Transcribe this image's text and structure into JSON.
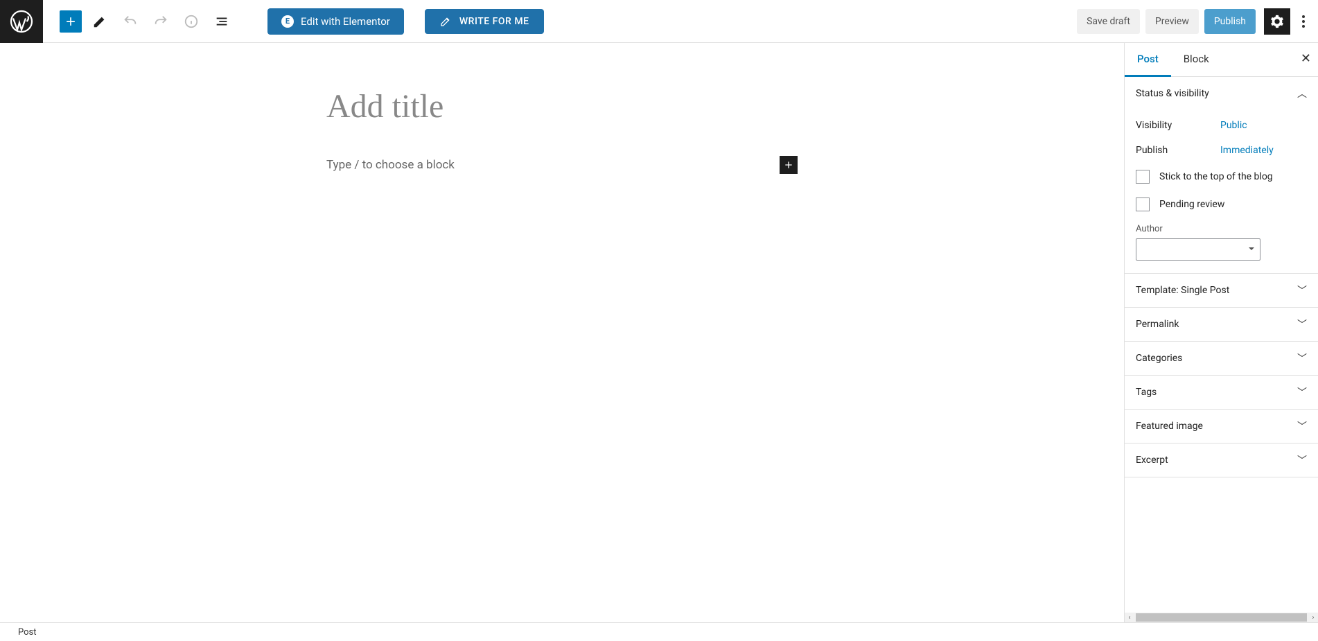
{
  "toolbar": {
    "elementor_label": "Edit with Elementor",
    "write_label": "WRITE FOR ME",
    "save_draft": "Save draft",
    "preview": "Preview",
    "publish": "Publish"
  },
  "editor": {
    "title_placeholder": "Add title",
    "block_prompt": "Type / to choose a block"
  },
  "sidebar": {
    "tabs": {
      "post": "Post",
      "block": "Block"
    },
    "panels": {
      "status": {
        "title": "Status & visibility",
        "visibility_label": "Visibility",
        "visibility_value": "Public",
        "publish_label": "Publish",
        "publish_value": "Immediately",
        "stick_label": "Stick to the top of the blog",
        "pending_label": "Pending review",
        "author_label": "Author"
      },
      "template": "Template: Single Post",
      "permalink": "Permalink",
      "categories": "Categories",
      "tags": "Tags",
      "featured": "Featured image",
      "excerpt": "Excerpt"
    }
  },
  "footer": {
    "breadcrumb": "Post"
  }
}
